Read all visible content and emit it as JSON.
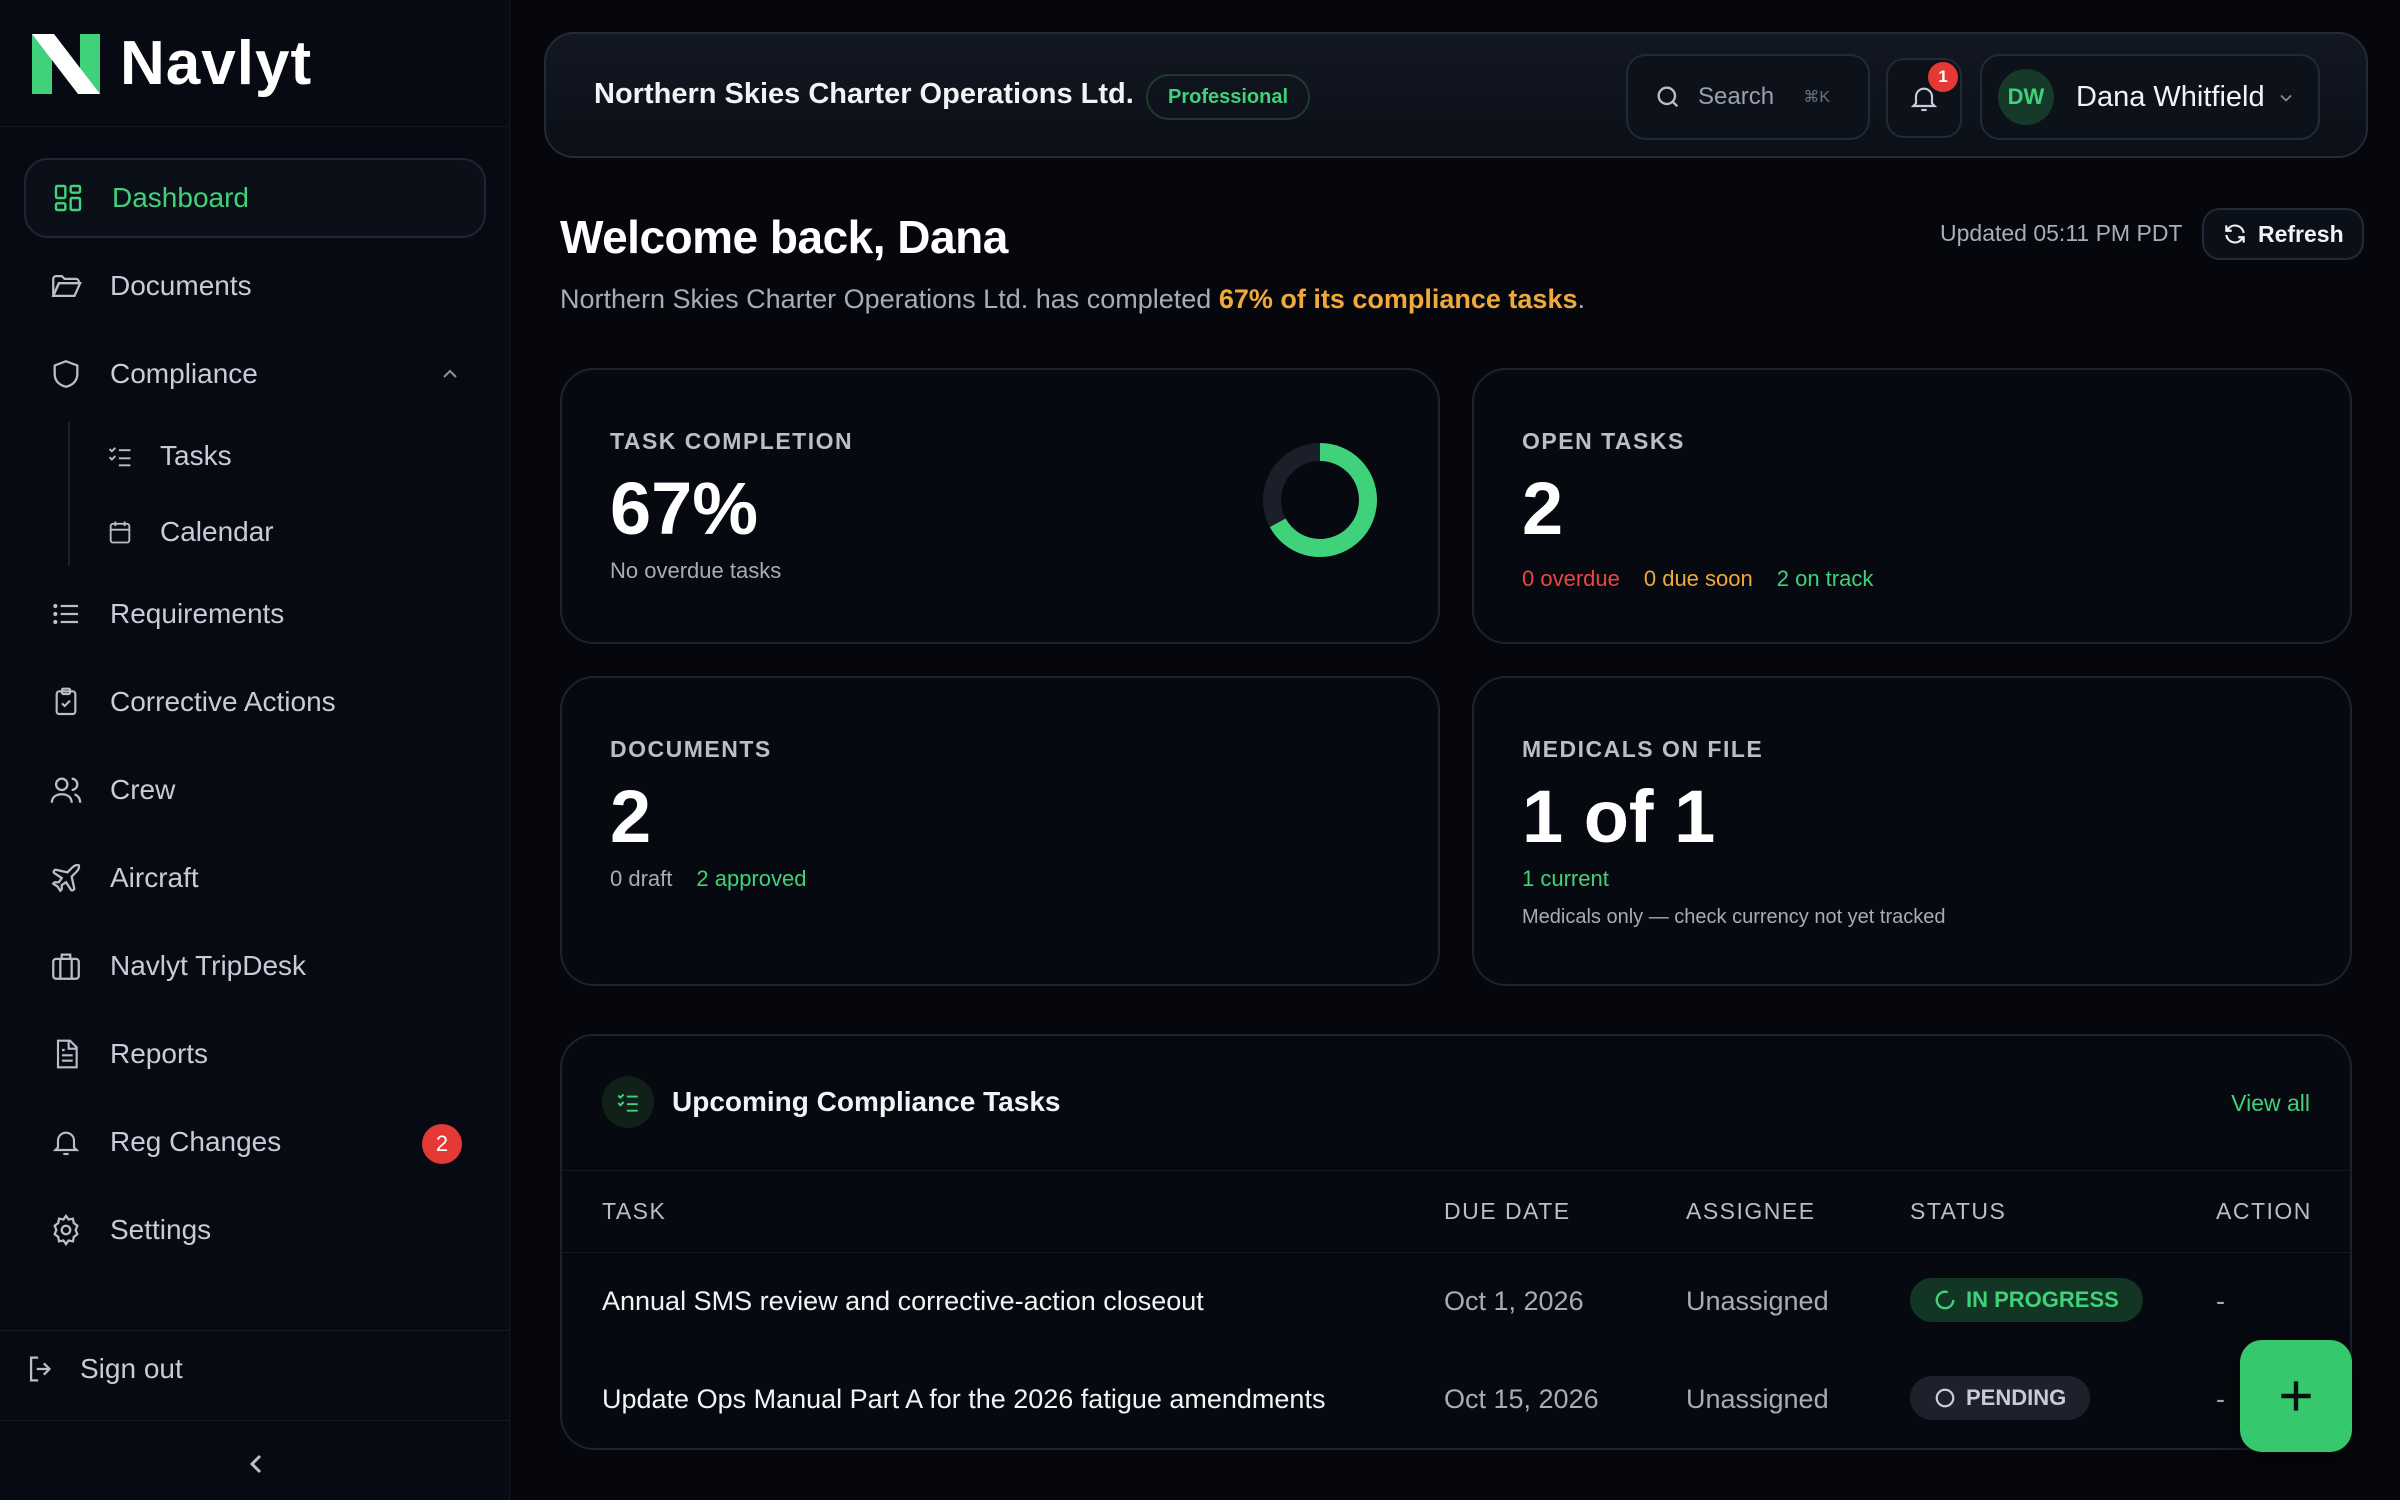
{
  "app": {
    "name": "Navlyt"
  },
  "sidebar": {
    "items": [
      {
        "label": "Dashboard",
        "icon": "dashboard-icon"
      },
      {
        "label": "Documents",
        "icon": "folder-icon"
      },
      {
        "label": "Compliance",
        "icon": "shield-icon"
      },
      {
        "label": "Tasks",
        "icon": "checklist-icon"
      },
      {
        "label": "Calendar",
        "icon": "calendar-icon"
      },
      {
        "label": "Requirements",
        "icon": "list-icon"
      },
      {
        "label": "Corrective Actions",
        "icon": "clipboard-check-icon"
      },
      {
        "label": "Crew",
        "icon": "users-icon"
      },
      {
        "label": "Aircraft",
        "icon": "plane-icon"
      },
      {
        "label": "Navlyt TripDesk",
        "icon": "briefcase-icon"
      },
      {
        "label": "Reports",
        "icon": "report-icon"
      },
      {
        "label": "Reg Changes",
        "icon": "bell-icon",
        "badge": "2"
      },
      {
        "label": "Settings",
        "icon": "gear-icon"
      }
    ],
    "sign_out": "Sign out"
  },
  "header": {
    "org_name": "Northern Skies Charter Operations Ltd.",
    "plan": "Professional",
    "search_placeholder": "Search",
    "search_shortcut": "⌘K",
    "notifications_count": "1",
    "user_initials": "DW",
    "user_name": "Dana Whitfield"
  },
  "welcome": {
    "title": "Welcome back, Dana",
    "sub_prefix": "Northern Skies Charter Operations Ltd. has completed ",
    "sub_highlight": "67% of its compliance tasks",
    "sub_suffix": ".",
    "updated": "Updated 05:11 PM PDT",
    "refresh": "Refresh"
  },
  "stats": {
    "task_completion": {
      "title": "TASK COMPLETION",
      "value": "67%",
      "sub": "No overdue tasks",
      "percent": 67
    },
    "open_tasks": {
      "title": "OPEN TASKS",
      "value": "2",
      "overdue": "0 overdue",
      "due_soon": "0 due soon",
      "on_track": "2 on track"
    },
    "documents": {
      "title": "DOCUMENTS",
      "value": "2",
      "draft": "0 draft",
      "approved": "2 approved"
    },
    "medicals": {
      "title": "MEDICALS ON FILE",
      "value": "1 of 1",
      "current": "1 current",
      "note": "Medicals only — check currency not yet tracked"
    }
  },
  "tasks": {
    "title": "Upcoming Compliance Tasks",
    "view_all": "View all",
    "columns": [
      "TASK",
      "DUE DATE",
      "ASSIGNEE",
      "STATUS",
      "ACTION"
    ],
    "rows": [
      {
        "task": "Annual SMS review and corrective-action closeout",
        "due": "Oct 1, 2026",
        "assignee": "Unassigned",
        "status": "IN PROGRESS",
        "action": "-"
      },
      {
        "task": "Update Ops Manual Part A for the 2026 fatigue amendments",
        "due": "Oct 15, 2026",
        "assignee": "Unassigned",
        "status": "PENDING",
        "action": "-"
      }
    ]
  },
  "colors": {
    "accent": "#3fd27a",
    "warning": "#f0a93a",
    "danger": "#ef4444",
    "background": "#05070d"
  }
}
